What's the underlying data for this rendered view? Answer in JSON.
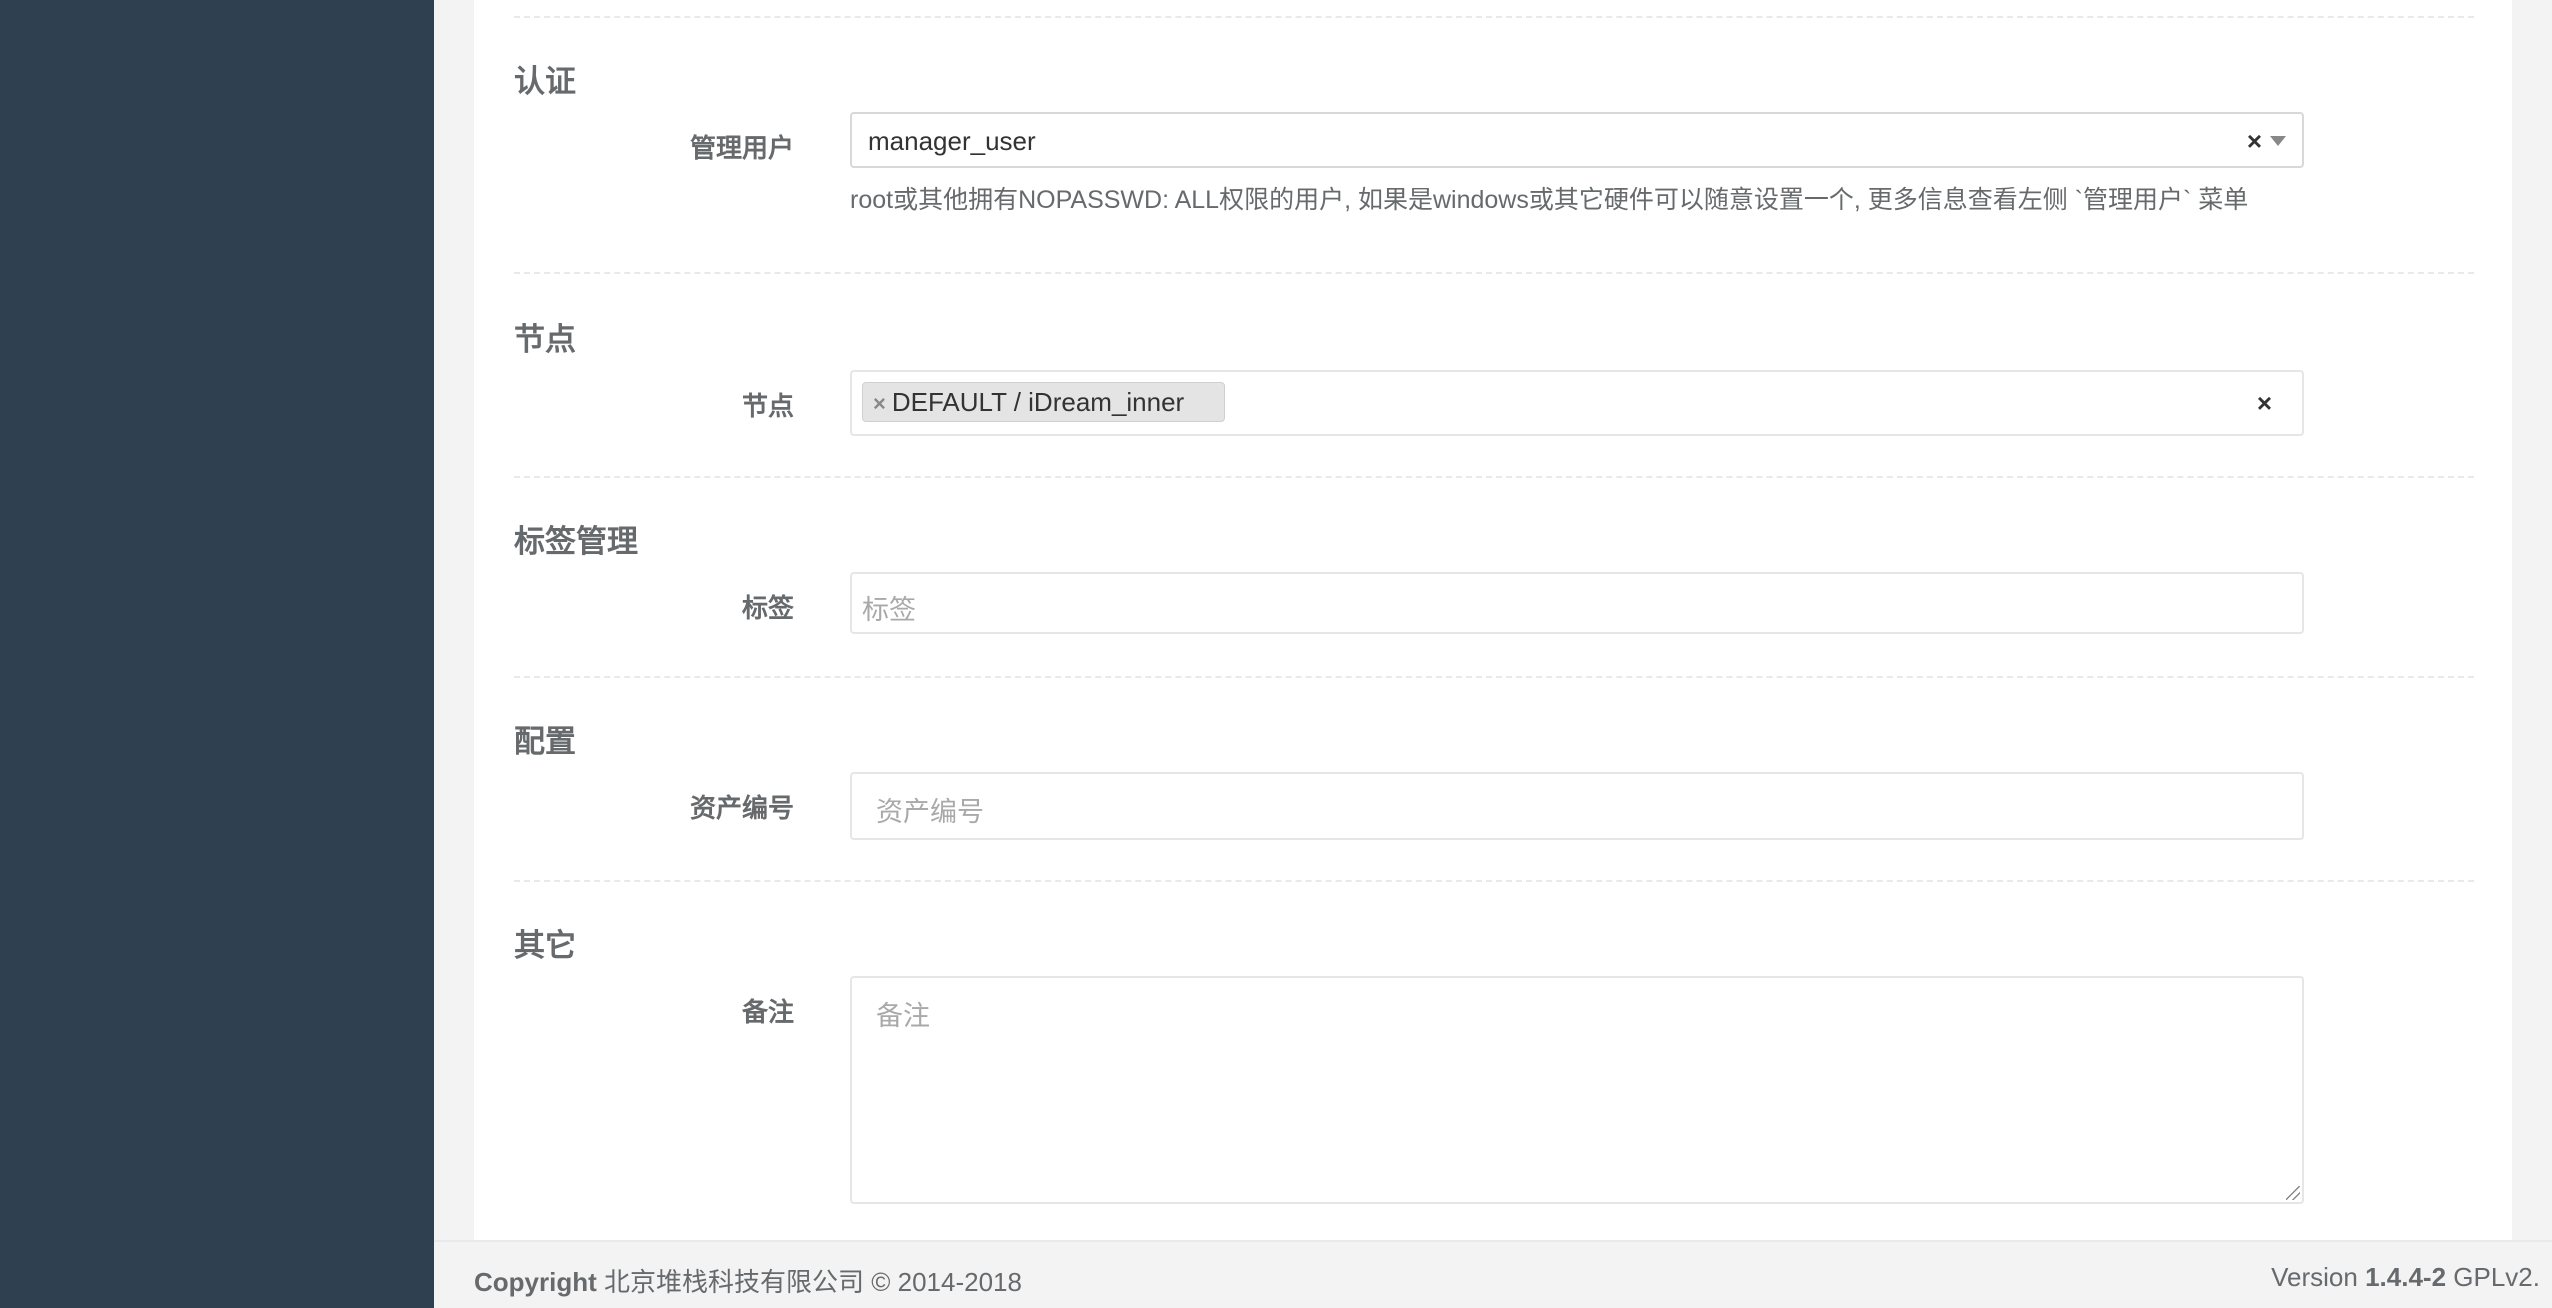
{
  "sections": {
    "auth": {
      "title": "认证",
      "admin_user": {
        "label": "管理用户",
        "value": "manager_user",
        "clear": "×",
        "help": "root或其他拥有NOPASSWD: ALL权限的用户, 如果是windows或其它硬件可以随意设置一个, 更多信息查看左侧 `管理用户` 菜单"
      }
    },
    "nodes": {
      "title": "节点",
      "field": {
        "label": "节点",
        "tag_remove": "×",
        "tags": [
          "DEFAULT / iDream_inner"
        ],
        "clear": "×"
      }
    },
    "labels": {
      "title": "标签管理",
      "field": {
        "label": "标签",
        "placeholder": "标签"
      }
    },
    "config": {
      "title": "配置",
      "field": {
        "label": "资产编号",
        "placeholder": "资产编号"
      }
    },
    "other": {
      "title": "其它",
      "field": {
        "label": "备注",
        "placeholder": "备注"
      }
    }
  },
  "footer": {
    "copyright_label": "Copyright",
    "copyright_text": "北京堆栈科技有限公司 © 2014-2018",
    "version_label": "Version",
    "version_number": "1.4.4-2",
    "license": "GPLv2."
  }
}
